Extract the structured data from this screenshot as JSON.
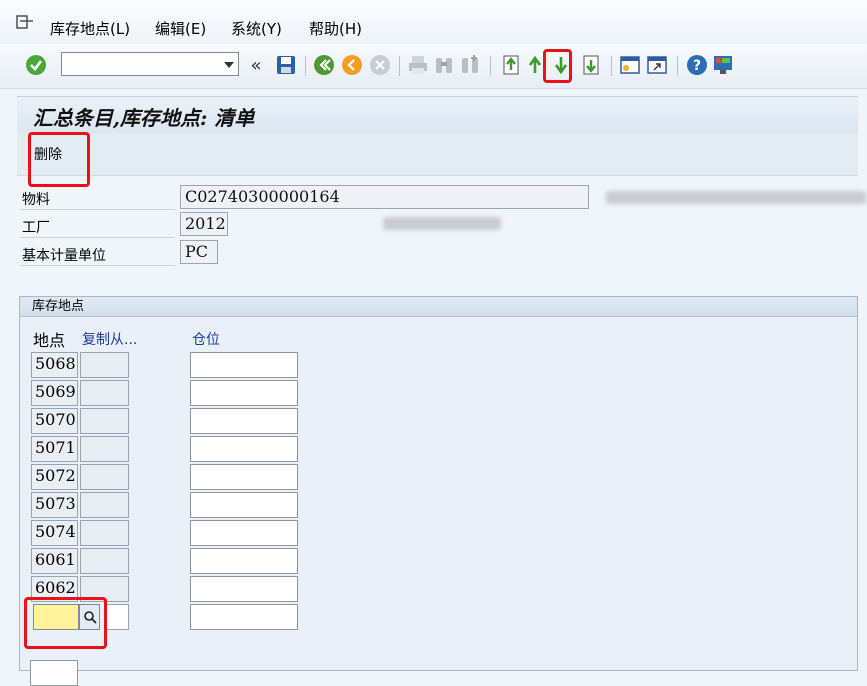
{
  "menu": {
    "items": [
      "库存地点(L)",
      "编辑(E)",
      "系统(Y)",
      "帮助(H)"
    ]
  },
  "toolbar": {
    "command_value": "",
    "buttons": [
      "enter-icon",
      "back-icon",
      "exit-icon",
      "cancel-icon",
      "print-icon",
      "find-icon",
      "find-next-icon",
      "first-page-icon",
      "previous-page-icon",
      "next-page-icon",
      "last-page-icon",
      "create-session-icon",
      "shortcut-icon",
      "help-icon",
      "customize-layout-icon"
    ]
  },
  "title": "汇总条目,库存地点: 清单",
  "app_toolbar": {
    "delete_label": "删除"
  },
  "header_fields": {
    "material_label": "物料",
    "material_value": "C02740300000164",
    "plant_label": "工厂",
    "plant_value": "2012",
    "uom_label": "基本计量单位",
    "uom_value": "PC"
  },
  "storage": {
    "group_title": "库存地点",
    "col_location": "地点",
    "col_copy_from": "复制从...",
    "col_bin": "仓位",
    "rows": [
      {
        "location": "5068",
        "copy": "",
        "bin": ""
      },
      {
        "location": "5069",
        "copy": "",
        "bin": ""
      },
      {
        "location": "5070",
        "copy": "",
        "bin": ""
      },
      {
        "location": "5071",
        "copy": "",
        "bin": ""
      },
      {
        "location": "5072",
        "copy": "",
        "bin": ""
      },
      {
        "location": "5073",
        "copy": "",
        "bin": ""
      },
      {
        "location": "5074",
        "copy": "",
        "bin": ""
      },
      {
        "location": "6061",
        "copy": "",
        "bin": ""
      },
      {
        "location": "6062",
        "copy": "",
        "bin": ""
      }
    ],
    "new_row_value": ""
  },
  "colors": {
    "highlight_box": "#e8121b",
    "link_blue": "#1a3c9a",
    "active_field": "#fff29a"
  }
}
